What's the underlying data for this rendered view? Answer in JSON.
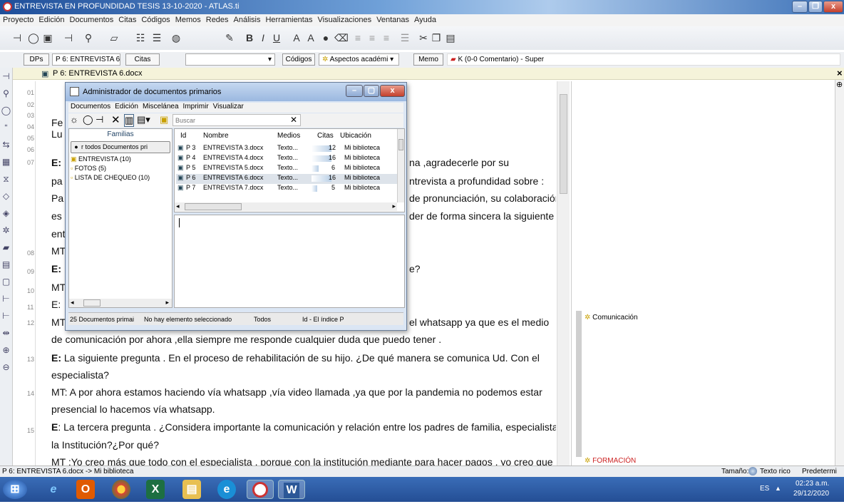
{
  "window": {
    "title": "ENTREVISTA EN PROFUNDIDAD TESIS 13-10-2020 - ATLAS.ti"
  },
  "menu": [
    "Proyecto",
    "Edición",
    "Documentos",
    "Citas",
    "Códigos",
    "Memos",
    "Redes",
    "Análisis",
    "Herramientas",
    "Visualizaciones",
    "Ventanas",
    "Ayuda"
  ],
  "toolbar2": {
    "dps": "DPs",
    "doc_combo": "P 6: ENTREVISTA 6",
    "citas": "Citas",
    "codigos": "Códigos",
    "code_combo": "Aspectos académi",
    "memo": "Memo",
    "memo_combo": "K (0-0 Comentario) - Super"
  },
  "doc_tab": "P 6: ENTREVISTA 6.docx",
  "line_numbers": [
    "01",
    "02",
    "03",
    "04",
    "05",
    "06",
    "07",
    "08",
    "09",
    "10",
    "11",
    "12",
    "13",
    "14",
    "15"
  ],
  "text_lines": [
    "Fe",
    "Lu",
    "E:",
    "na ,agradecerle  por su",
    "pa",
    "ntrevista a profundidad sobre :",
    "Pa",
    "de pronunciación, su  colaboración",
    "es",
    "der de forma sincera la siguiente",
    "ent",
    "MT",
    "E:",
    "e?",
    "MT",
    "E:",
    "MT",
    "el whatsapp ya que es el medio",
    "de comunicación por ahora ,ella siempre me responde cualquier duda que puedo tener .",
    "E:",
    " La siguiente pregunta . En el proceso de rehabilitación de su hijo. ¿De qué manera se comunica Ud. Con el",
    "especialista?",
    "MT: A por ahora estamos haciendo vía whatsapp ,vía video llamada ,ya que por la pandemia no podemos estar",
    "presencial lo hacemos vía whatsapp.",
    "E",
    ": La tercera pregunta . ¿Considera importante la comunicación  y relación entre los padres de familia, especialista y",
    "la Institución?¿Por qué?",
    "MT :Yo creo más que todo con el especialista , porque con la institución mediante para hacer pagos , yo creo que con"
  ],
  "margin_codes": [
    "Comunicación",
    "FORMACIÓN"
  ],
  "dialog": {
    "title": "Administrador de documentos primarios",
    "menu": [
      "Documentos",
      "Edición",
      "Miscelánea",
      "Imprimir",
      "Visualizar"
    ],
    "search_placeholder": "Buscar",
    "families_header": "Familias",
    "show_all": "r todos Documentos pri",
    "families": [
      "ENTREVISTA (10)",
      "FOTOS (5)",
      "LISTA DE CHEQUEO (10)"
    ],
    "columns": [
      "Id",
      "Nombre",
      "Medios",
      "Citas",
      "Ubicación"
    ],
    "rows": [
      {
        "id": "P 3",
        "name": "ENTREVISTA 3.docx",
        "medios": "Texto...",
        "citas": "12",
        "loc": "Mi biblioteca"
      },
      {
        "id": "P 4",
        "name": "ENTREVISTA 4.docx",
        "medios": "Texto...",
        "citas": "16",
        "loc": "Mi biblioteca"
      },
      {
        "id": "P 5",
        "name": "ENTREVISTA 5.docx",
        "medios": "Texto...",
        "citas": "6",
        "loc": "Mi biblioteca"
      },
      {
        "id": "P 6",
        "name": "ENTREVISTA 6.docx",
        "medios": "Texto...",
        "citas": "16",
        "loc": "Mi biblioteca"
      },
      {
        "id": "P 7",
        "name": "ENTREVISTA 7.docx",
        "medios": "Texto...",
        "citas": "5",
        "loc": "Mi biblioteca"
      }
    ],
    "status": [
      "25 Documentos primai",
      "No hay elemento seleccionado",
      "Todos",
      "Id - El índice P"
    ]
  },
  "statusbar": {
    "left": "P 6: ENTREVISTA 6.docx -> Mi biblioteca",
    "right": [
      "Tamaño:",
      "Texto rico",
      "Predetermi"
    ]
  },
  "taskbar": {
    "lang": "ES",
    "time": "02:23 a.m.",
    "date": "29/12/2020"
  },
  "colors": {
    "accent": "#2a5aa8",
    "doc_tab_bg": "#f5f3da",
    "code_red": "#c22"
  }
}
